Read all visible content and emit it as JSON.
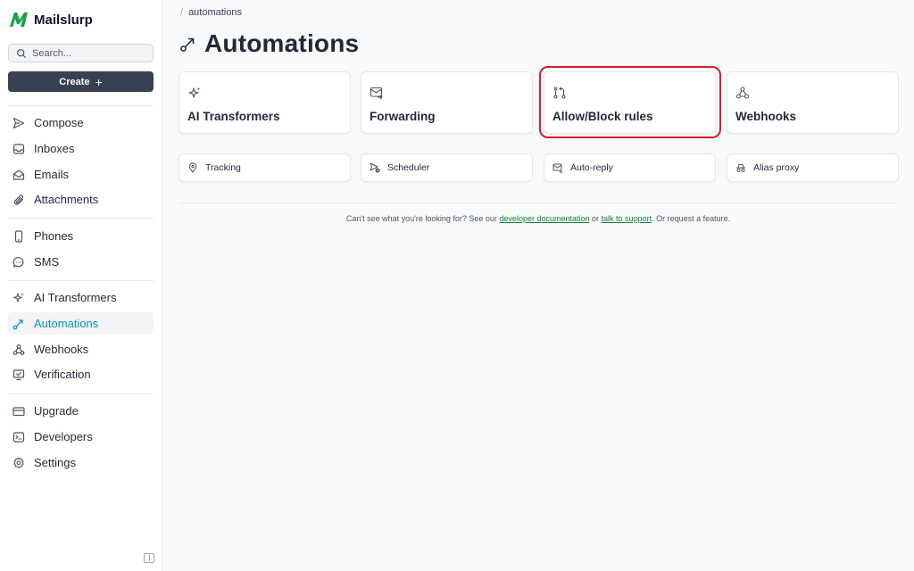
{
  "app": {
    "brand": "Mailslurp"
  },
  "search": {
    "placeholder": "Search..."
  },
  "create": {
    "label": "Create",
    "plus": "+"
  },
  "nav": {
    "items": [
      {
        "label": "Compose",
        "icon": "send-icon"
      },
      {
        "label": "Inboxes",
        "icon": "inbox-icon"
      },
      {
        "label": "Emails",
        "icon": "envelope-open-icon"
      },
      {
        "label": "Attachments",
        "icon": "paperclip-icon"
      },
      {
        "label": "Phones",
        "icon": "phone-icon"
      },
      {
        "label": "SMS",
        "icon": "chat-bubble-icon"
      },
      {
        "label": "AI Transformers",
        "icon": "sparkles-icon"
      },
      {
        "label": "Automations",
        "icon": "route-icon",
        "active": true
      },
      {
        "label": "Webhooks",
        "icon": "webhook-icon"
      },
      {
        "label": "Verification",
        "icon": "monitor-check-icon"
      },
      {
        "label": "Upgrade",
        "icon": "credit-card-icon"
      },
      {
        "label": "Developers",
        "icon": "terminal-icon"
      },
      {
        "label": "Settings",
        "icon": "gear-icon"
      }
    ]
  },
  "breadcrumb": {
    "separator": "/",
    "current": "automations"
  },
  "page": {
    "title": "Automations"
  },
  "cards": [
    {
      "label": "AI Transformers",
      "icon": "sparkles-icon"
    },
    {
      "label": "Forwarding",
      "icon": "forward-mail-icon"
    },
    {
      "label": "Allow/Block rules",
      "icon": "git-compare-icon"
    },
    {
      "label": "Webhooks",
      "icon": "webhook-icon"
    }
  ],
  "small_cards": [
    {
      "label": "Tracking",
      "icon": "map-pin-icon"
    },
    {
      "label": "Scheduler",
      "icon": "send-clock-icon"
    },
    {
      "label": "Auto-reply",
      "icon": "reply-mail-icon"
    },
    {
      "label": "Alias proxy",
      "icon": "incognito-icon"
    }
  ],
  "footer": {
    "prefix": "Can't see what you're looking for? See our",
    "doc_link": "developer documentation",
    "middle": "or",
    "support_link": "talk to support",
    "suffix": ". Or request a feature."
  },
  "colors": {
    "accent": "#0e8fc2",
    "highlight": "#d11f2a",
    "brand_green": "#16a34a",
    "create_bg": "#374151"
  }
}
